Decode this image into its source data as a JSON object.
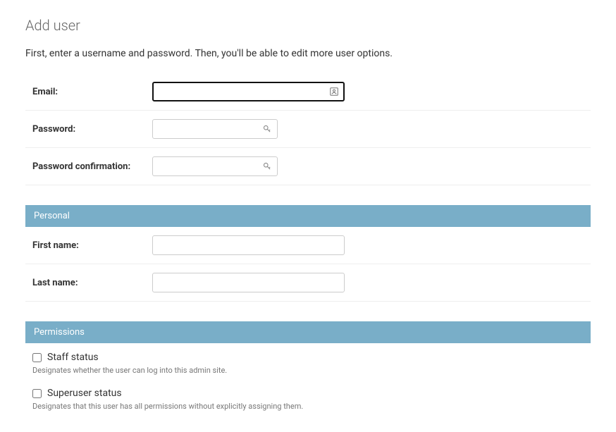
{
  "page": {
    "title": "Add user",
    "intro": "First, enter a username and password. Then, you'll be able to edit more user options."
  },
  "fields": {
    "email": {
      "label": "Email:",
      "value": ""
    },
    "password": {
      "label": "Password:",
      "value": ""
    },
    "password_confirm": {
      "label": "Password confirmation:",
      "value": ""
    },
    "first_name": {
      "label": "First name:",
      "value": ""
    },
    "last_name": {
      "label": "Last name:",
      "value": ""
    }
  },
  "sections": {
    "personal": "Personal",
    "permissions": "Permissions"
  },
  "permissions": {
    "staff": {
      "label": "Staff status",
      "help": "Designates whether the user can log into this admin site.",
      "checked": false
    },
    "superuser": {
      "label": "Superuser status",
      "help": "Designates that this user has all permissions without explicitly assigning them.",
      "checked": false
    }
  }
}
